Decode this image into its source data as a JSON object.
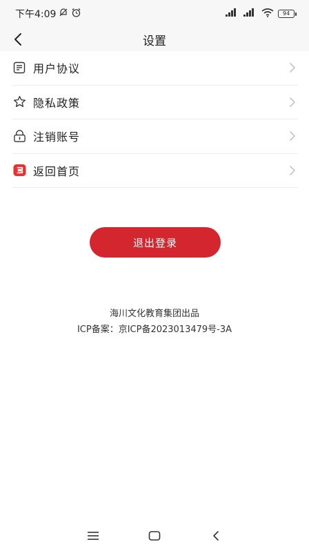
{
  "status_bar": {
    "time": "下午4:09",
    "battery": "94"
  },
  "nav": {
    "title": "设置"
  },
  "menu": [
    {
      "label": "用户协议",
      "icon": "document-icon"
    },
    {
      "label": "隐私政策",
      "icon": "star-icon"
    },
    {
      "label": "注销账号",
      "icon": "lock-icon"
    },
    {
      "label": "返回首页",
      "icon": "home-badge-icon"
    }
  ],
  "logout": {
    "label": "退出登录",
    "color": "#d3262e"
  },
  "footer": {
    "company": "海川文化教育集团出品",
    "icp": "ICP备案：京ICP备2023013479号-3A"
  }
}
